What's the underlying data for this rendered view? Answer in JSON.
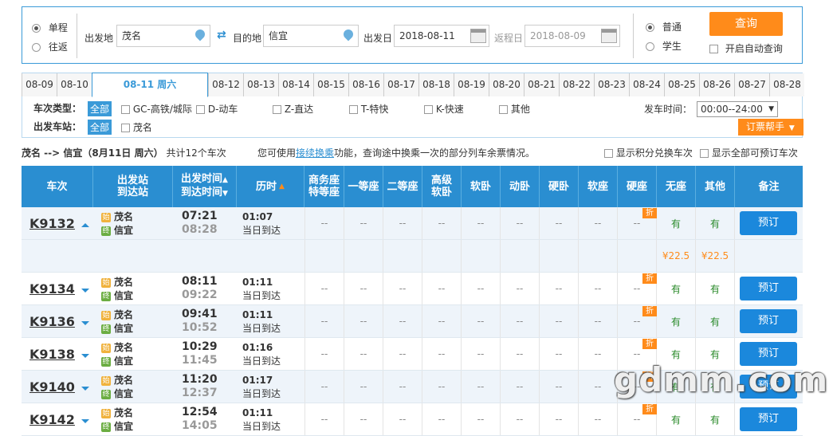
{
  "search": {
    "trip_types": [
      "单程",
      "往返"
    ],
    "from_label": "出发地",
    "from_value": "茂名",
    "to_label": "目的地",
    "to_value": "信宜",
    "depart_label": "出发日",
    "depart_value": "2018-08-11",
    "return_label": "返程日",
    "return_value": "2018-08-09",
    "passenger_types": [
      "普通",
      "学生"
    ],
    "query_button": "查询",
    "auto_query_label": "开启自动查询"
  },
  "date_tabs": [
    "08-09",
    "08-10",
    "08-11 周六",
    "08-12",
    "08-13",
    "08-14",
    "08-15",
    "08-16",
    "08-17",
    "08-18",
    "08-19",
    "08-20",
    "08-21",
    "08-22",
    "08-23",
    "08-24",
    "08-25",
    "08-26",
    "08-27",
    "08-28"
  ],
  "filter": {
    "type_label": "车次类型：",
    "all_label": "全部",
    "types": [
      "GC-高铁/城际",
      "D-动车",
      "Z-直达",
      "T-特快",
      "K-快速",
      "其他"
    ],
    "station_label": "出发车站：",
    "stations": [
      "茂名"
    ],
    "time_label": "发车时间：",
    "time_value": "00:00--24:00",
    "help_label": "订票帮手"
  },
  "summary": {
    "route": "茂名 --> 信宜（8月11日  周六）",
    "count": "共计12个车次",
    "transfer_text_a": "您可使用",
    "transfer_link": "接续换乘",
    "transfer_text_b": "功能，查询途中换乘一次的部分列车余票情况。",
    "option_points": "显示积分兑换车次",
    "option_all": "显示全部可预订车次"
  },
  "table_headers": {
    "train": "车次",
    "stations_a": "出发站",
    "stations_b": "到达站",
    "times_a": "出发时间",
    "times_b": "到达时间",
    "duration": "历时",
    "business_a": "商务座",
    "business_b": "特等座",
    "first": "一等座",
    "second": "二等座",
    "soft_premium_a": "高级",
    "soft_premium_b": "软卧",
    "soft_sleeper": "软卧",
    "moving_sleeper": "动卧",
    "hard_sleeper": "硬卧",
    "soft_seat": "软座",
    "hard_seat": "硬座",
    "no_seat": "无座",
    "other": "其他",
    "remark": "备注"
  },
  "trains": [
    {
      "no": "K9132",
      "from": "茂名",
      "to": "信宜",
      "dep": "07:21",
      "arr": "08:28",
      "dur": "01:07",
      "note": "当日到达",
      "hard_seat": "有",
      "no_seat": "有",
      "empty": "--",
      "book": "预订",
      "start_badge": "始",
      "end_badge": "终",
      "discount": "折",
      "expanded": true,
      "price_hard": "¥22.5",
      "price_none": "¥22.5"
    },
    {
      "no": "K9134",
      "from": "茂名",
      "to": "信宜",
      "dep": "08:11",
      "arr": "09:22",
      "dur": "01:11",
      "note": "当日到达",
      "hard_seat": "有",
      "no_seat": "有",
      "empty": "--",
      "book": "预订",
      "start_badge": "始",
      "end_badge": "终",
      "discount": "折"
    },
    {
      "no": "K9136",
      "from": "茂名",
      "to": "信宜",
      "dep": "09:41",
      "arr": "10:52",
      "dur": "01:11",
      "note": "当日到达",
      "hard_seat": "有",
      "no_seat": "有",
      "empty": "--",
      "book": "预订",
      "start_badge": "始",
      "end_badge": "终",
      "discount": "折"
    },
    {
      "no": "K9138",
      "from": "茂名",
      "to": "信宜",
      "dep": "10:29",
      "arr": "11:45",
      "dur": "01:16",
      "note": "当日到达",
      "hard_seat": "有",
      "no_seat": "有",
      "empty": "--",
      "book": "预订",
      "start_badge": "始",
      "end_badge": "终",
      "discount": "折"
    },
    {
      "no": "K9140",
      "from": "茂名",
      "to": "信宜",
      "dep": "11:20",
      "arr": "12:37",
      "dur": "01:17",
      "note": "当日到达",
      "hard_seat": "有",
      "no_seat": "有",
      "empty": "--",
      "book": "预订",
      "start_badge": "始",
      "end_badge": "终",
      "discount": "折"
    },
    {
      "no": "K9142",
      "from": "茂名",
      "to": "信宜",
      "dep": "12:54",
      "arr": "14:05",
      "dur": "01:11",
      "note": "当日到达",
      "hard_seat": "有",
      "no_seat": "有",
      "empty": "--",
      "book": "预订",
      "start_badge": "始",
      "end_badge": "终",
      "discount": "折"
    }
  ],
  "watermark": "gdmm.com",
  "colors": {
    "accent": "#2a8ed1",
    "orange": "#ff8b1a",
    "green": "#2a8a2a"
  }
}
